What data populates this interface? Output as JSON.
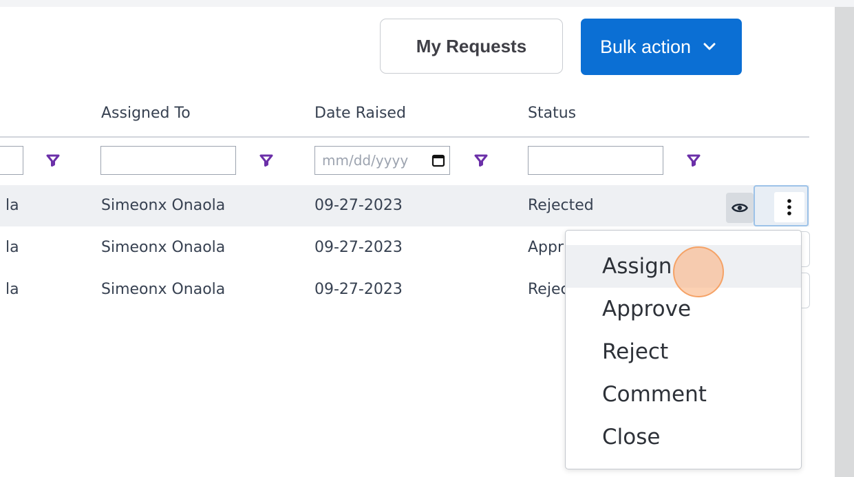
{
  "toolbar": {
    "my_requests_label": "My Requests",
    "bulk_action_label": "Bulk action"
  },
  "table": {
    "columns": [
      {
        "key": "assigned_to",
        "label": "Assigned To"
      },
      {
        "key": "date_raised",
        "label": "Date Raised"
      },
      {
        "key": "status",
        "label": "Status"
      }
    ],
    "filters": {
      "date_placeholder": "mm/dd/yyyy"
    },
    "rows": [
      {
        "requester_fragment": "la",
        "assigned_to": "Simeonx Onaola",
        "date_raised": "09-27-2023",
        "status": "Rejected",
        "selected": true
      },
      {
        "requester_fragment": "la",
        "assigned_to": "Simeonx Onaola",
        "date_raised": "09-27-2023",
        "status": "Appr"
      },
      {
        "requester_fragment": "la",
        "assigned_to": "Simeonx Onaola",
        "date_raised": "09-27-2023",
        "status": "Rejec"
      }
    ]
  },
  "row_actions_menu": {
    "items": [
      "Assign",
      "Approve",
      "Reject",
      "Comment",
      "Close"
    ],
    "hovered_index": 0
  },
  "icons": {
    "filter": "filter-funnel-icon",
    "calendar": "calendar-icon",
    "view": "eye-icon",
    "more": "kebab-vertical-icon",
    "dropdown": "chevron-down-icon"
  },
  "colors": {
    "primary": "#0b6fd4",
    "filter_icon": "#6b2fa8",
    "selected_row": "#eef0f3",
    "click_indicator": "#f5a266"
  }
}
